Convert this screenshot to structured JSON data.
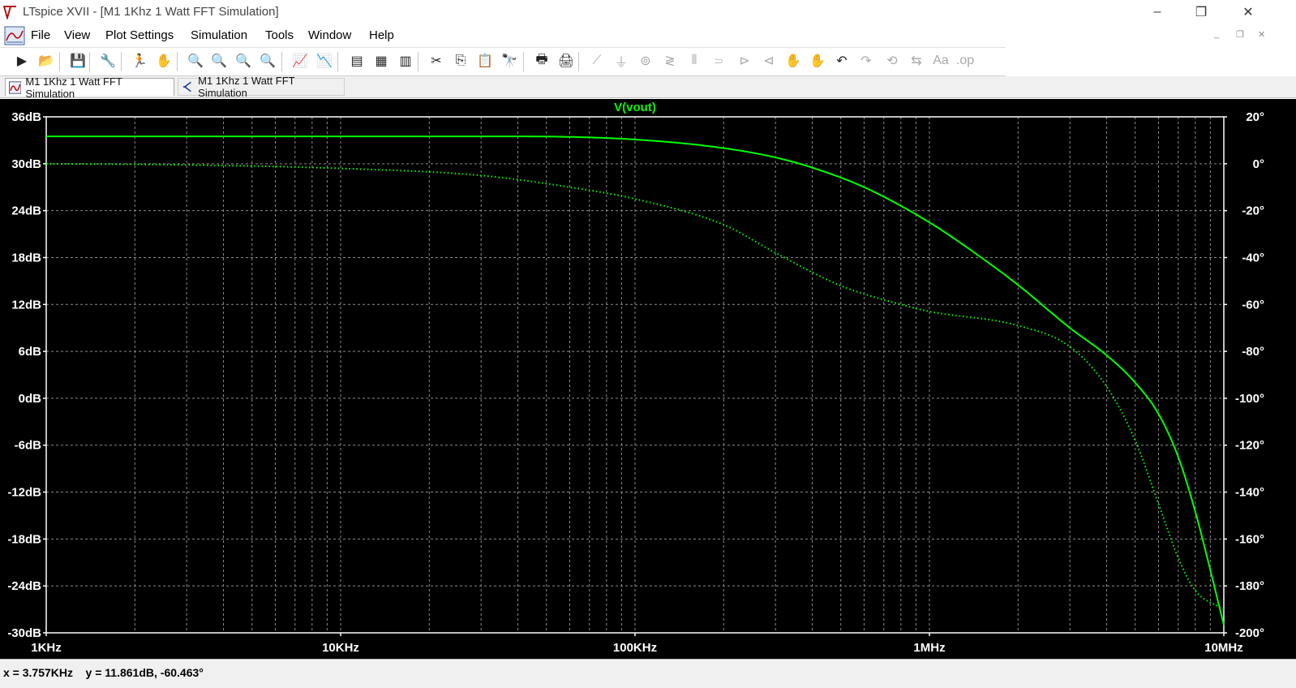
{
  "window": {
    "title": "LTspice XVII - [M1 1Khz 1 Watt FFT Simulation]",
    "minimize": "–",
    "restore": "❐",
    "close": "✕"
  },
  "menu": {
    "items": [
      "File",
      "View",
      "Plot Settings",
      "Simulation",
      "Tools",
      "Window",
      "Help"
    ],
    "mdi_minimize": "_",
    "mdi_restore": "❐",
    "mdi_close": "✕"
  },
  "toolbar": {
    "buttons": [
      {
        "icon": "run-icon",
        "glyph": "▶"
      },
      {
        "icon": "open-icon",
        "glyph": "📂"
      },
      {
        "icon": "save-icon",
        "glyph": "💾"
      },
      {
        "icon": "control-panel-icon",
        "glyph": "🔧"
      },
      {
        "icon": "run-simulation-icon",
        "glyph": "🏃"
      },
      {
        "icon": "halt-hand-icon",
        "glyph": "✋"
      },
      {
        "icon": "zoom-in-icon",
        "glyph": "🔍"
      },
      {
        "icon": "zoom-full-icon",
        "glyph": "🔍"
      },
      {
        "icon": "zoom-out-icon",
        "glyph": "🔍"
      },
      {
        "icon": "zoom-cancel-icon",
        "glyph": "🔍"
      },
      {
        "icon": "autorange-icon",
        "glyph": "📈"
      },
      {
        "icon": "add-trace-icon",
        "glyph": "📉"
      },
      {
        "icon": "tile-horizontal-icon",
        "glyph": "▤"
      },
      {
        "icon": "cascade-icon",
        "glyph": "▦"
      },
      {
        "icon": "tile-vertical-icon",
        "glyph": "▥"
      },
      {
        "icon": "cut-icon",
        "glyph": "✂"
      },
      {
        "icon": "copy-icon",
        "glyph": "⎘"
      },
      {
        "icon": "paste-icon",
        "glyph": "📋"
      },
      {
        "icon": "find-icon",
        "glyph": "🔭"
      },
      {
        "icon": "print-icon",
        "glyph": "🖶"
      },
      {
        "icon": "print-preview-icon",
        "glyph": "🖨"
      },
      {
        "icon": "wire-icon",
        "glyph": "⟋"
      },
      {
        "icon": "ground-icon",
        "glyph": "⏚"
      },
      {
        "icon": "label-net-icon",
        "glyph": "⊚"
      },
      {
        "icon": "resistor-icon",
        "glyph": "≷"
      },
      {
        "icon": "capacitor-icon",
        "glyph": "⫴"
      },
      {
        "icon": "inductor-icon",
        "glyph": "⸧"
      },
      {
        "icon": "diode-icon",
        "glyph": "⊳"
      },
      {
        "icon": "component-icon",
        "glyph": "⊲"
      },
      {
        "icon": "move-hand-icon",
        "glyph": "✋"
      },
      {
        "icon": "drag-hand-icon",
        "glyph": "✋"
      },
      {
        "icon": "undo-icon",
        "glyph": "↶"
      },
      {
        "icon": "redo-icon",
        "glyph": "↷"
      },
      {
        "icon": "rotate-icon",
        "glyph": "⟲"
      },
      {
        "icon": "mirror-icon",
        "glyph": "⇆"
      },
      {
        "icon": "text-icon",
        "glyph": "Aa"
      },
      {
        "icon": "spice-directive-icon",
        "glyph": ".op"
      }
    ]
  },
  "tabs": [
    {
      "label": "M1 1Khz 1 Watt FFT Simulation",
      "icon": "waveform-icon",
      "active": true
    },
    {
      "label": "M1 1Khz 1 Watt FFT Simulation",
      "icon": "schematic-icon",
      "active": false
    }
  ],
  "plot": {
    "trace_name": "V(vout)",
    "trace_color": "#00ff00",
    "grid_color": "#8c8c8c",
    "background": "#000000"
  },
  "chart_data": {
    "type": "line",
    "title": "V(vout)",
    "x_scale": "log",
    "x_ticks": [
      "1KHz",
      "10KHz",
      "100KHz",
      "1MHz",
      "10MHz"
    ],
    "x_tick_values": [
      1000,
      10000,
      100000,
      1000000,
      10000000
    ],
    "xlim": [
      1000,
      10000000
    ],
    "y_left_ticks": [
      "36dB",
      "30dB",
      "24dB",
      "18dB",
      "12dB",
      "6dB",
      "0dB",
      "-6dB",
      "-12dB",
      "-18dB",
      "-24dB",
      "-30dB"
    ],
    "y_left_values": [
      36,
      30,
      24,
      18,
      12,
      6,
      0,
      -6,
      -12,
      -18,
      -24,
      -30
    ],
    "ylim_left": [
      -30,
      36
    ],
    "y_right_ticks": [
      "20°",
      "0°",
      "-20°",
      "-40°",
      "-60°",
      "-80°",
      "-100°",
      "-120°",
      "-140°",
      "-160°",
      "-180°",
      "-200°"
    ],
    "y_right_values": [
      20,
      0,
      -20,
      -40,
      -60,
      -80,
      -100,
      -120,
      -140,
      -160,
      -180,
      -200
    ],
    "ylim_right": [
      -200,
      20
    ],
    "series": [
      {
        "name": "V(vout)",
        "quantity": "magnitude (dB)",
        "axis": "left",
        "style": "solid",
        "x": [
          1000,
          10000,
          40000,
          100000,
          200000,
          300000,
          400000,
          600000,
          1000000,
          1500000,
          2000000,
          3000000,
          4000000,
          5000000,
          6000000,
          7000000,
          8000000,
          9000000,
          10000000
        ],
        "y": [
          33.5,
          33.5,
          33.5,
          33.1,
          32.0,
          30.8,
          29.5,
          27.0,
          22.5,
          18.0,
          14.5,
          9.0,
          5.5,
          2.0,
          -2.0,
          -7.5,
          -14.5,
          -22.0,
          -29.0
        ]
      },
      {
        "name": "V(vout)",
        "quantity": "phase (°)",
        "axis": "right",
        "style": "dotted",
        "x": [
          1000,
          3000,
          10000,
          30000,
          60000,
          100000,
          200000,
          300000,
          500000,
          800000,
          1000000,
          2000000,
          3000000,
          4000000,
          5000000,
          6000000,
          7000000,
          8000000,
          10000000
        ],
        "y": [
          0,
          -0.5,
          -2,
          -5,
          -10,
          -15,
          -26,
          -38,
          -52,
          -60,
          -63,
          -69,
          -78,
          -95,
          -118,
          -145,
          -168,
          -182,
          -190
        ]
      }
    ]
  },
  "status": {
    "readout": "x = 3.757KHz    y = 11.861dB, -60.463°"
  }
}
